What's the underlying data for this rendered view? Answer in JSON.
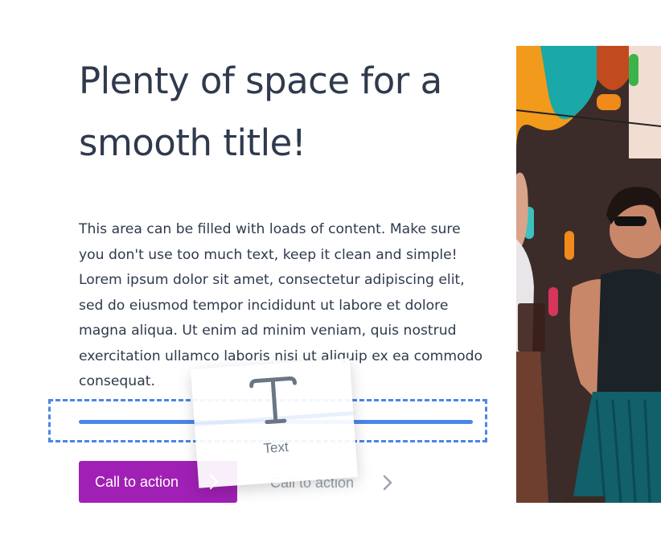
{
  "hero": {
    "title": "Plenty of space for a smooth title!",
    "body": "This area can be filled with loads of content. Make sure you don't use too much text, keep it clean and simple! Lorem ipsum dolor sit amet, consectetur adipiscing elit, sed do eiusmod tempor incididunt ut labore et dolore magna aliqua. Ut enim ad minim veniam, quis nostrud exercitation ullamco laboris nisi ut aliquip ex ea commodo consequat."
  },
  "actions": {
    "primary_label": "Call to action",
    "secondary_label": "Call to action"
  },
  "drag_card": {
    "icon": "text-icon",
    "label": "Text"
  },
  "colors": {
    "primary_button": "#a020b5",
    "drop_indicator": "#4a86e8",
    "text": "#2f3a4d"
  }
}
